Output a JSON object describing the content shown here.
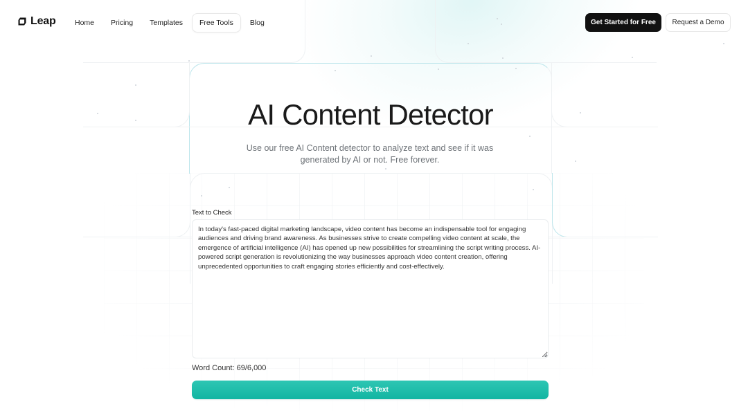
{
  "brand": {
    "name": "Leap",
    "logo_icon": "leap-logo-icon"
  },
  "nav": {
    "links": [
      {
        "label": "Home",
        "active": false
      },
      {
        "label": "Pricing",
        "active": false
      },
      {
        "label": "Templates",
        "active": false
      },
      {
        "label": "Free Tools",
        "active": true
      },
      {
        "label": "Blog",
        "active": false
      }
    ],
    "cta_primary": "Get Started for Free",
    "cta_secondary": "Request a Demo"
  },
  "hero": {
    "title": "AI Content Detector",
    "subtitle": "Use our free AI Content detector to analyze text and see if it was generated by AI or not. Free forever."
  },
  "form": {
    "label": "Text to Check",
    "text_value": "In today's fast-paced digital marketing landscape, video content has become an indispensable tool for engaging audiences and driving brand awareness. As businesses strive to create compelling video content at scale, the emergence of artificial intelligence (AI) has opened up new possibilities for streamlining the script writing process. AI-powered script generation is revolutionizing the way businesses approach video content creation, offering unprecedented opportunities to craft engaging stories efficiently and cost-effectively.",
    "word_count_label": "Word Count: 69/6,000",
    "submit_label": "Check Text"
  },
  "colors": {
    "accent": "#1ABCA8",
    "primary_button": "#111111",
    "text_muted": "#6E7378"
  }
}
